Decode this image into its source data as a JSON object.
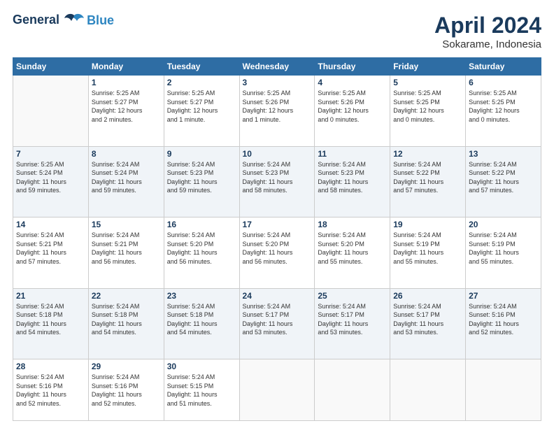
{
  "header": {
    "logo_line1": "General",
    "logo_line2": "Blue",
    "month": "April 2024",
    "location": "Sokarame, Indonesia"
  },
  "weekdays": [
    "Sunday",
    "Monday",
    "Tuesday",
    "Wednesday",
    "Thursday",
    "Friday",
    "Saturday"
  ],
  "weeks": [
    [
      {
        "day": "",
        "info": ""
      },
      {
        "day": "1",
        "info": "Sunrise: 5:25 AM\nSunset: 5:27 PM\nDaylight: 12 hours\nand 2 minutes."
      },
      {
        "day": "2",
        "info": "Sunrise: 5:25 AM\nSunset: 5:27 PM\nDaylight: 12 hours\nand 1 minute."
      },
      {
        "day": "3",
        "info": "Sunrise: 5:25 AM\nSunset: 5:26 PM\nDaylight: 12 hours\nand 1 minute."
      },
      {
        "day": "4",
        "info": "Sunrise: 5:25 AM\nSunset: 5:26 PM\nDaylight: 12 hours\nand 0 minutes."
      },
      {
        "day": "5",
        "info": "Sunrise: 5:25 AM\nSunset: 5:25 PM\nDaylight: 12 hours\nand 0 minutes."
      },
      {
        "day": "6",
        "info": "Sunrise: 5:25 AM\nSunset: 5:25 PM\nDaylight: 12 hours\nand 0 minutes."
      }
    ],
    [
      {
        "day": "7",
        "info": "Sunrise: 5:25 AM\nSunset: 5:24 PM\nDaylight: 11 hours\nand 59 minutes."
      },
      {
        "day": "8",
        "info": "Sunrise: 5:24 AM\nSunset: 5:24 PM\nDaylight: 11 hours\nand 59 minutes."
      },
      {
        "day": "9",
        "info": "Sunrise: 5:24 AM\nSunset: 5:23 PM\nDaylight: 11 hours\nand 59 minutes."
      },
      {
        "day": "10",
        "info": "Sunrise: 5:24 AM\nSunset: 5:23 PM\nDaylight: 11 hours\nand 58 minutes."
      },
      {
        "day": "11",
        "info": "Sunrise: 5:24 AM\nSunset: 5:23 PM\nDaylight: 11 hours\nand 58 minutes."
      },
      {
        "day": "12",
        "info": "Sunrise: 5:24 AM\nSunset: 5:22 PM\nDaylight: 11 hours\nand 57 minutes."
      },
      {
        "day": "13",
        "info": "Sunrise: 5:24 AM\nSunset: 5:22 PM\nDaylight: 11 hours\nand 57 minutes."
      }
    ],
    [
      {
        "day": "14",
        "info": "Sunrise: 5:24 AM\nSunset: 5:21 PM\nDaylight: 11 hours\nand 57 minutes."
      },
      {
        "day": "15",
        "info": "Sunrise: 5:24 AM\nSunset: 5:21 PM\nDaylight: 11 hours\nand 56 minutes."
      },
      {
        "day": "16",
        "info": "Sunrise: 5:24 AM\nSunset: 5:20 PM\nDaylight: 11 hours\nand 56 minutes."
      },
      {
        "day": "17",
        "info": "Sunrise: 5:24 AM\nSunset: 5:20 PM\nDaylight: 11 hours\nand 56 minutes."
      },
      {
        "day": "18",
        "info": "Sunrise: 5:24 AM\nSunset: 5:20 PM\nDaylight: 11 hours\nand 55 minutes."
      },
      {
        "day": "19",
        "info": "Sunrise: 5:24 AM\nSunset: 5:19 PM\nDaylight: 11 hours\nand 55 minutes."
      },
      {
        "day": "20",
        "info": "Sunrise: 5:24 AM\nSunset: 5:19 PM\nDaylight: 11 hours\nand 55 minutes."
      }
    ],
    [
      {
        "day": "21",
        "info": "Sunrise: 5:24 AM\nSunset: 5:18 PM\nDaylight: 11 hours\nand 54 minutes."
      },
      {
        "day": "22",
        "info": "Sunrise: 5:24 AM\nSunset: 5:18 PM\nDaylight: 11 hours\nand 54 minutes."
      },
      {
        "day": "23",
        "info": "Sunrise: 5:24 AM\nSunset: 5:18 PM\nDaylight: 11 hours\nand 54 minutes."
      },
      {
        "day": "24",
        "info": "Sunrise: 5:24 AM\nSunset: 5:17 PM\nDaylight: 11 hours\nand 53 minutes."
      },
      {
        "day": "25",
        "info": "Sunrise: 5:24 AM\nSunset: 5:17 PM\nDaylight: 11 hours\nand 53 minutes."
      },
      {
        "day": "26",
        "info": "Sunrise: 5:24 AM\nSunset: 5:17 PM\nDaylight: 11 hours\nand 53 minutes."
      },
      {
        "day": "27",
        "info": "Sunrise: 5:24 AM\nSunset: 5:16 PM\nDaylight: 11 hours\nand 52 minutes."
      }
    ],
    [
      {
        "day": "28",
        "info": "Sunrise: 5:24 AM\nSunset: 5:16 PM\nDaylight: 11 hours\nand 52 minutes."
      },
      {
        "day": "29",
        "info": "Sunrise: 5:24 AM\nSunset: 5:16 PM\nDaylight: 11 hours\nand 52 minutes."
      },
      {
        "day": "30",
        "info": "Sunrise: 5:24 AM\nSunset: 5:15 PM\nDaylight: 11 hours\nand 51 minutes."
      },
      {
        "day": "",
        "info": ""
      },
      {
        "day": "",
        "info": ""
      },
      {
        "day": "",
        "info": ""
      },
      {
        "day": "",
        "info": ""
      }
    ]
  ]
}
